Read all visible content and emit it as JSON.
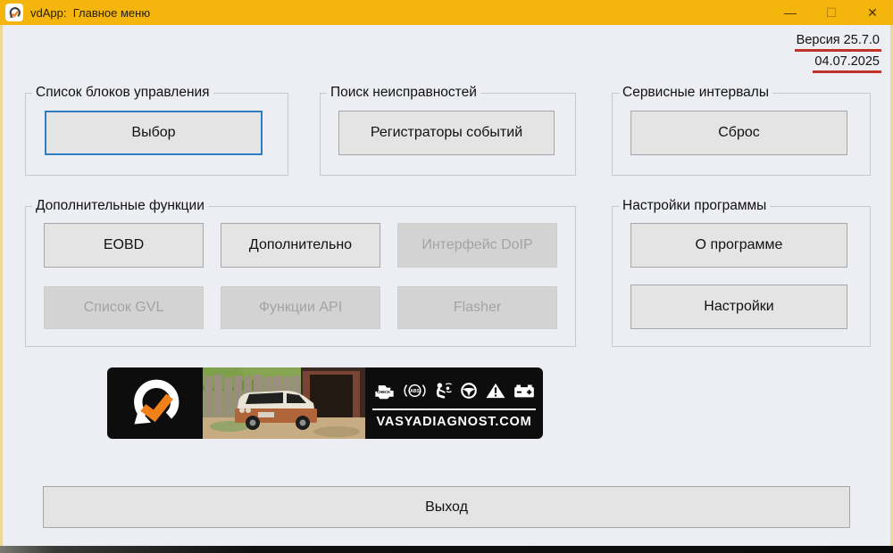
{
  "window": {
    "title": "vdApp:  Главное меню",
    "controls": {
      "minimize": "—",
      "maximize": "☐",
      "close": "✕"
    }
  },
  "version": {
    "line1": "Версия 25.7.0",
    "line2": "04.07.2025"
  },
  "groups": [
    {
      "label": "Список блоков управления",
      "buttons": [
        {
          "label": "Выбор",
          "enabled": true,
          "focused": true
        }
      ]
    },
    {
      "label": "Поиск неисправностей",
      "buttons": [
        {
          "label": "Регистраторы событий",
          "enabled": true
        }
      ]
    },
    {
      "label": "Сервисные интервалы",
      "buttons": [
        {
          "label": "Сброс",
          "enabled": true
        }
      ]
    },
    {
      "label": "Дополнительные функции",
      "buttons": [
        {
          "label": "EOBD",
          "enabled": true
        },
        {
          "label": "Дополнительно",
          "enabled": true
        },
        {
          "label": "Интерфейс DoIP",
          "enabled": false
        },
        {
          "label": "Список GVL",
          "enabled": false
        },
        {
          "label": "Функции API",
          "enabled": false
        },
        {
          "label": "Flasher",
          "enabled": false
        }
      ]
    },
    {
      "label": "Настройки программы",
      "buttons": [
        {
          "label": "О программе",
          "enabled": true
        },
        {
          "label": "Настройки",
          "enabled": true
        }
      ]
    }
  ],
  "banner": {
    "website": "VASYADIAGNOST.COM",
    "icons": [
      "check-engine-icon",
      "abs-icon",
      "airbag-icon",
      "steering-wheel-icon",
      "warning-triangle-icon",
      "battery-icon"
    ]
  },
  "exit": {
    "label": "Выход"
  },
  "colors": {
    "titlebar": "#F4B50C",
    "frame": "#EADA96",
    "background": "#EDEEF3",
    "accent_red_underline": "#BE3428",
    "focus_blue": "#2E7FC2",
    "banner_bg": "#0D0D0D",
    "logo_orange": "#F08019"
  }
}
